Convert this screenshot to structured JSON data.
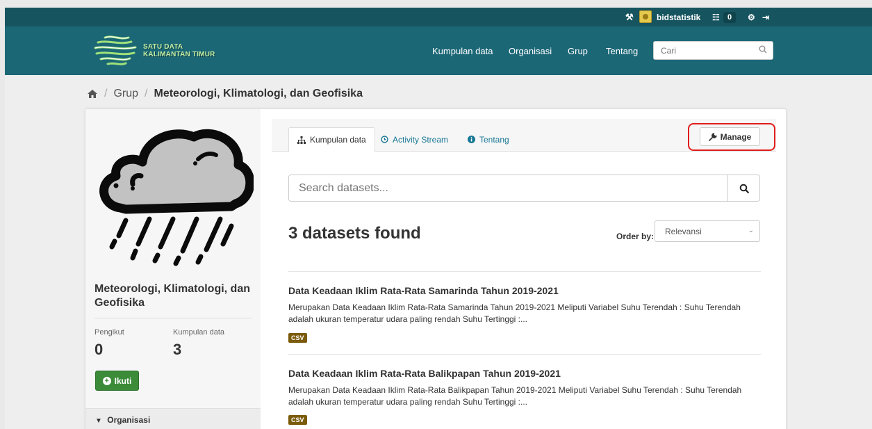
{
  "account": {
    "username": "bidstatistik",
    "dashboard_count": "0",
    "icons": [
      "tools-icon",
      "avatar",
      "dashboard-icon",
      "gear-icon",
      "logout-icon"
    ]
  },
  "masthead": {
    "logo_line1": "SATU DATA",
    "logo_line2": "KALIMANTAN TIMUR",
    "nav": [
      "Kumpulan data",
      "Organisasi",
      "Grup",
      "Tentang"
    ],
    "search_placeholder": "Cari"
  },
  "breadcrumb": {
    "home_icon": "home-icon",
    "items": [
      "Grup",
      "Meteorologi, Klimatologi, dan Geofisika"
    ]
  },
  "sidebar": {
    "group_name": "Meteorologi, Klimatologi, dan Geofisika",
    "followers_label": "Pengikut",
    "followers_value": "0",
    "datasets_label": "Kumpulan data",
    "datasets_value": "3",
    "follow_label": "Ikuti",
    "organization_header": "Organisasi"
  },
  "tabs": [
    {
      "label": "Kumpulan data",
      "icon": "sitemap-icon",
      "active": true
    },
    {
      "label": "Activity Stream",
      "icon": "clock-icon",
      "active": false
    },
    {
      "label": "Tentang",
      "icon": "info-icon",
      "active": false
    }
  ],
  "manage_label": "Manage",
  "search": {
    "placeholder": "Search datasets..."
  },
  "results": {
    "count_text": "3 datasets found",
    "order_label": "Order by:",
    "order_value": "Relevansi"
  },
  "datasets": [
    {
      "title": "Data Keadaan Iklim Rata-Rata Samarinda Tahun 2019-2021",
      "notes_1": "Merupakan Data Keadaan Iklim Rata-Rata Samarinda Tahun 2019-2021 Meliputi Variabel Suhu Terendah : Suhu Terendah",
      "notes_2": "adalah ukuran temperatur udara paling rendah Suhu Tertinggi :...",
      "format": "CSV"
    },
    {
      "title": "Data Keadaan Iklim Rata-Rata Balikpapan Tahun 2019-2021",
      "notes_1": "Merupakan Data Keadaan Iklim Rata-Rata Balikpapan Tahun 2019-2021 Meliputi Variabel Suhu Terendah : Suhu Terendah",
      "notes_2": "adalah ukuran temperatur udara paling rendah Suhu Tertinggi :...",
      "format": "CSV"
    }
  ],
  "colors": {
    "masthead": "#1b6776",
    "account_bar": "#16545f",
    "follow_button": "#3c8b39",
    "link": "#187794",
    "badge": "#7a5b0a",
    "highlight": "#e21c1c"
  }
}
